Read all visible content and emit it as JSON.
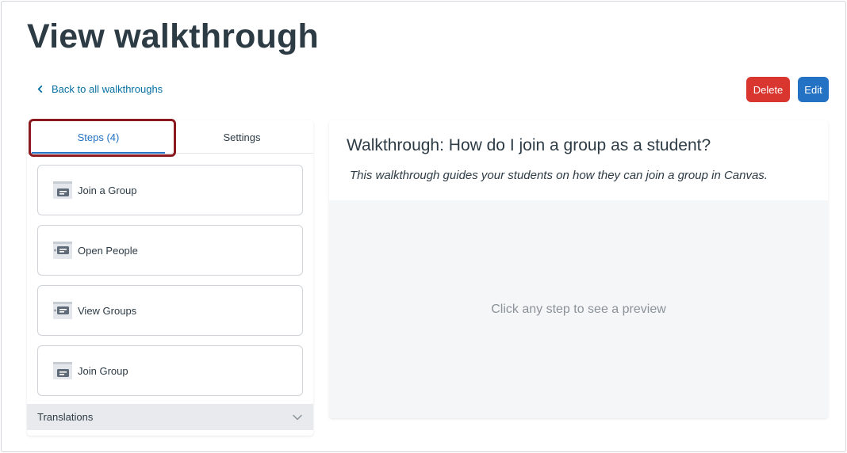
{
  "page": {
    "title": "View walkthrough",
    "back_link": "Back to all walkthroughs"
  },
  "actions": {
    "delete_label": "Delete",
    "edit_label": "Edit",
    "colors": {
      "delete": "#d9362f",
      "edit": "#2372c4"
    }
  },
  "tabs": [
    {
      "label": "Steps (4)",
      "active": true
    },
    {
      "label": "Settings",
      "active": false
    }
  ],
  "steps": [
    {
      "label": "Join a Group",
      "icon": "step-window-icon"
    },
    {
      "label": "Open People",
      "icon": "step-window-icon"
    },
    {
      "label": "View Groups",
      "icon": "step-window-icon"
    },
    {
      "label": "Join Group",
      "icon": "step-window-icon"
    }
  ],
  "translations": {
    "label": "Translations",
    "icon": "chevron-down-icon"
  },
  "walkthrough": {
    "title": "Walkthrough: How do I join a group as a student?",
    "description": "This walkthrough guides your students on how they can join a group in Canvas.",
    "preview_placeholder": "Click any step to see a preview"
  }
}
